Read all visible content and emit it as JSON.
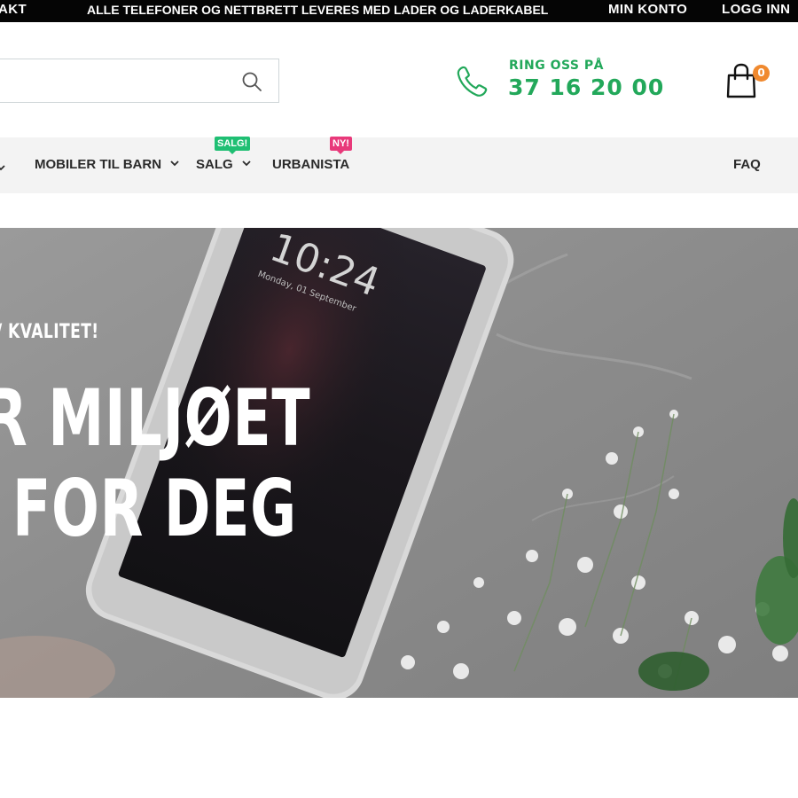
{
  "topbar": {
    "contact_fragment": "AKT",
    "announcement": "ALLE TELEFONER OG NETTBRETT LEVERES MED LADER OG LADERKABEL",
    "account_link": "MIN KONTO",
    "login_link": "LOGG INN"
  },
  "search": {
    "value": "",
    "placeholder": "",
    "icon": "search-icon"
  },
  "contact": {
    "icon": "phone-icon",
    "label": "RING OSS PÅ",
    "number": "37 16 20 00",
    "color": "#22a85a"
  },
  "cart": {
    "icon": "shopping-bag-icon",
    "count": "0",
    "badge_color": "#f0892e"
  },
  "nav": {
    "items": [
      {
        "label": "MOBILER TIL BARN",
        "has_dropdown": true
      },
      {
        "label": "SALG",
        "has_dropdown": true,
        "badge": "SALG!",
        "badge_color": "#1fbf73"
      },
      {
        "label": "URBANISTA",
        "has_dropdown": false,
        "badge": "NY!",
        "badge_color": "#e8397a"
      },
      {
        "label": "FAQ",
        "has_dropdown": false
      }
    ]
  },
  "hero": {
    "kicker": "/ KVALITET!",
    "headline_line1": "R MILJØET",
    "headline_line2": "FOR DEG",
    "phone_screen_time": "10:24",
    "phone_screen_date": "Monday, 01 September"
  }
}
